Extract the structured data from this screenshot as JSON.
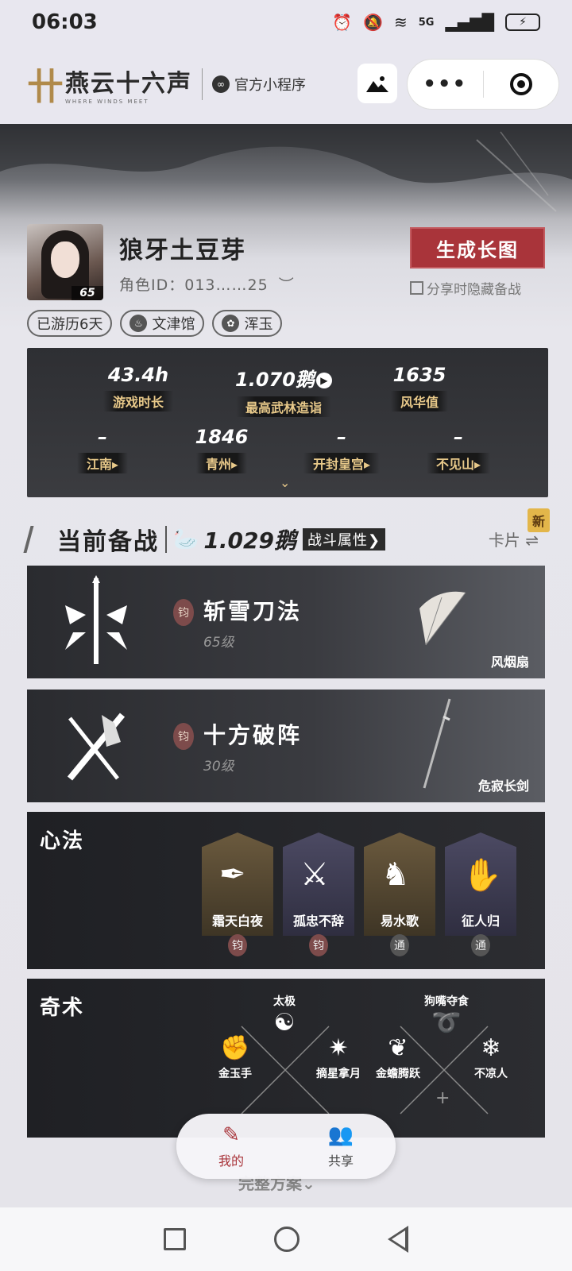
{
  "status_bar": {
    "time": "06:03",
    "network": "5G"
  },
  "header": {
    "logo_text": "燕云十六声",
    "logo_sub": "WHERE WINDS MEET",
    "mini_program_label": "官方小程序",
    "more_label": "•••"
  },
  "profile": {
    "name": "狼牙土豆芽",
    "role_id": "角色ID：013……25",
    "level": "65",
    "generate_button": "生成长图",
    "hide_option": "分享时隐藏备战",
    "tags": [
      {
        "label": "已游历6天"
      },
      {
        "label": "文津馆",
        "icon": "♨"
      },
      {
        "label": "浑玉",
        "icon": "✿"
      }
    ]
  },
  "stats": {
    "playtime": {
      "value": "43.4h",
      "label": "游戏时长"
    },
    "wulin": {
      "value": "1.070鹅",
      "label": "最高武林造诣"
    },
    "fenghua": {
      "value": "1635",
      "label": "风华值"
    },
    "regions": [
      {
        "value": "–",
        "label": "江南▸"
      },
      {
        "value": "1846",
        "label": "青州▸"
      },
      {
        "value": "–",
        "label": "开封皇宫▸"
      },
      {
        "value": "–",
        "label": "不见山▸"
      }
    ],
    "expand_icon": "⌄"
  },
  "battle": {
    "title": "当前备战",
    "score": "1.029鹅",
    "attr_button": "战斗属性❯",
    "cards_link": "卡片 ⇌",
    "new_badge": "新"
  },
  "weapons": [
    {
      "name": "斩雪刀法",
      "level": "65级",
      "badge": "钧",
      "item": "风烟扇"
    },
    {
      "name": "十方破阵",
      "level": "30级",
      "badge": "钧",
      "item": "危寂长剑"
    }
  ],
  "xinfa": {
    "title": "心法",
    "skills": [
      {
        "name": "霜天白夜",
        "tier": "钧",
        "glyph": "✒"
      },
      {
        "name": "孤忠不辞",
        "tier": "钧",
        "glyph": "⚔"
      },
      {
        "name": "易水歌",
        "tier": "通",
        "glyph": "♞"
      },
      {
        "name": "征人归",
        "tier": "通",
        "glyph": "✋"
      }
    ]
  },
  "qishu": {
    "title": "奇术",
    "groups": [
      {
        "top": "太极",
        "left": "金玉手",
        "right": "摘星拿月"
      },
      {
        "top": "狗嘴夺食",
        "left": "金蟾腾跃",
        "right": "不凉人"
      }
    ],
    "add_icon": "+"
  },
  "tabs": [
    {
      "label": "我的",
      "icon": "✎"
    },
    {
      "label": "共享",
      "icon": "👥"
    }
  ],
  "peek_text": "完整方案⌄"
}
